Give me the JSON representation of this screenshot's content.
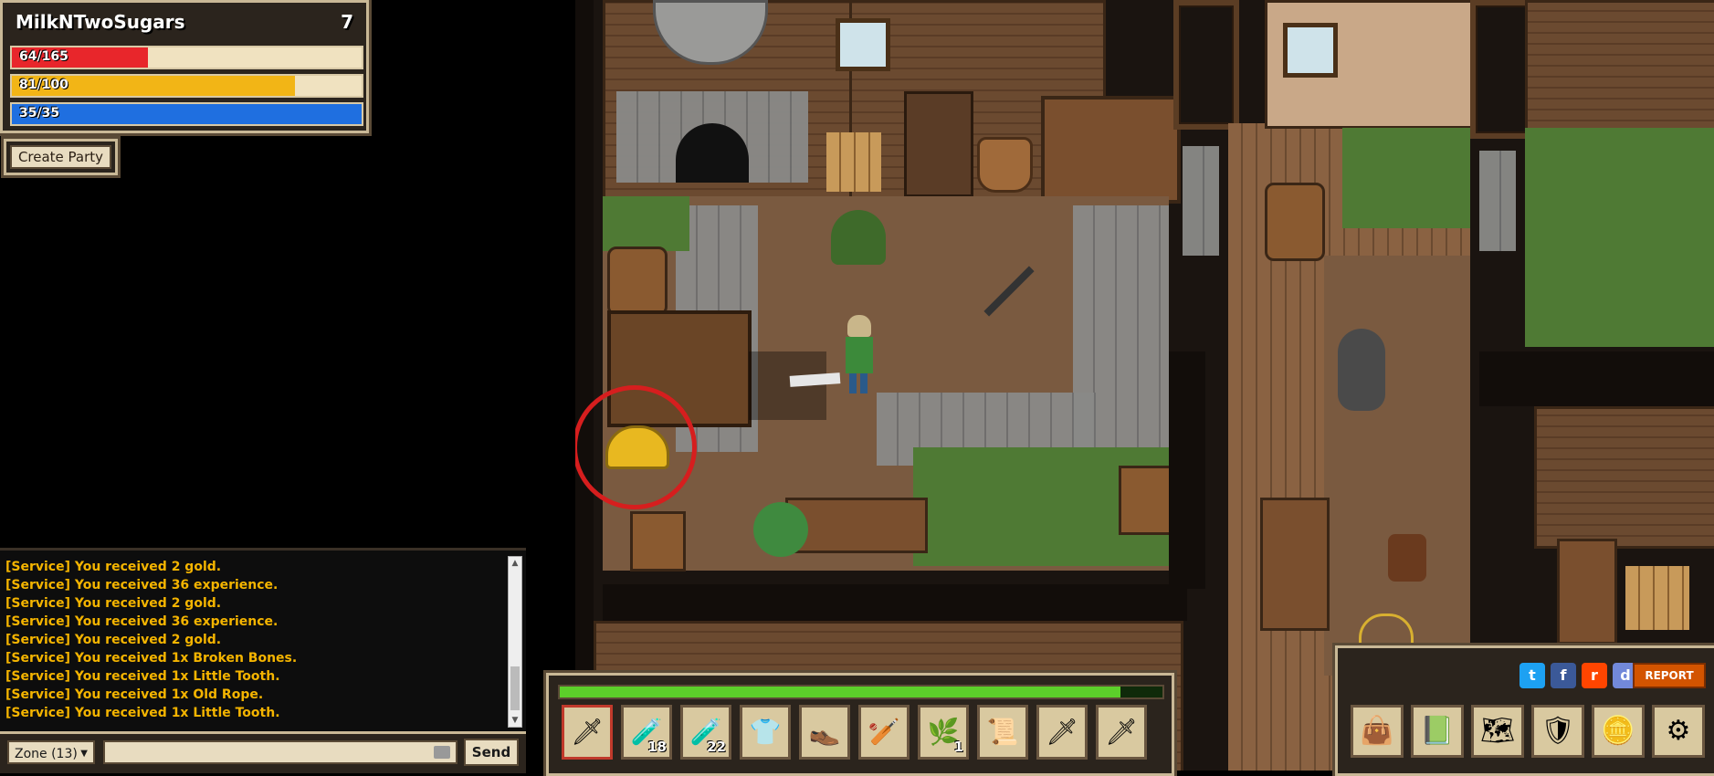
{
  "player": {
    "name": "MilkNTwoSugars",
    "level": "7",
    "hp": {
      "text": "64/165",
      "fraction": 0.388,
      "color": "#e8262b"
    },
    "stamina": {
      "text": "81/100",
      "fraction": 0.81,
      "color": "#f2b516"
    },
    "mana": {
      "text": "35/35",
      "fraction": 1.0,
      "color": "#1f6fe0"
    }
  },
  "party": {
    "create_label": "Create Party"
  },
  "chat": {
    "messages": [
      "[Service] You received 2 gold.",
      "[Service] You received 36 experience.",
      "[Service] You received 2 gold.",
      "[Service] You received 36 experience.",
      "[Service] You received 2 gold.",
      "[Service] You received 1x Broken Bones.",
      "[Service] You received 1x Little Tooth.",
      "[Service] You received 1x Old Rope.",
      "[Service] You received 1x Little Tooth."
    ],
    "message_color": "#f4b400",
    "zone_label": "Zone (13)",
    "input_value": "",
    "send_label": "Send"
  },
  "hotbar": {
    "xp_fraction": 0.93,
    "slots": [
      {
        "item": "sword-icon",
        "count": ""
      },
      {
        "item": "health-potion-icon",
        "count": "18"
      },
      {
        "item": "stamina-potion-icon",
        "count": "22"
      },
      {
        "item": "armor-shirt-icon",
        "count": ""
      },
      {
        "item": "boots-icon",
        "count": ""
      },
      {
        "item": "club-icon",
        "count": ""
      },
      {
        "item": "herb-icon",
        "count": "1"
      },
      {
        "item": "map-scroll-icon",
        "count": ""
      },
      {
        "item": "sword-icon",
        "count": ""
      },
      {
        "item": "sword-icon",
        "count": ""
      }
    ]
  },
  "menu": {
    "socials": [
      "twitter-icon",
      "facebook-icon",
      "reddit-icon",
      "discord-icon"
    ],
    "report_label": "REPORT",
    "buttons": [
      "inventory-bag-icon",
      "quest-book-icon",
      "world-map-icon",
      "character-icon",
      "gold-coins-icon",
      "settings-gear-icon"
    ]
  },
  "world": {
    "highlight_item": "gold-helmet-icon",
    "highlight_color": "#d61e1e"
  }
}
